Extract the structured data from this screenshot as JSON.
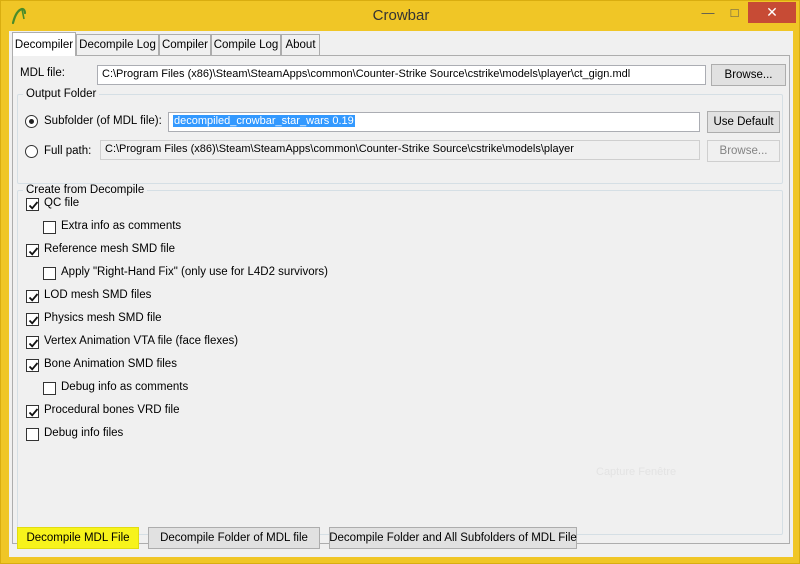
{
  "window": {
    "title": "Crowbar",
    "controls": {
      "minimize": "—",
      "maximize": "□",
      "close": "✕"
    }
  },
  "tabs": [
    "Decompiler",
    "Decompile Log",
    "Compiler",
    "Compile Log",
    "About"
  ],
  "mdl_file": {
    "label": "MDL file:",
    "value": "C:\\Program Files (x86)\\Steam\\SteamApps\\common\\Counter-Strike Source\\cstrike\\models\\player\\ct_gign.mdl",
    "browse": "Browse..."
  },
  "output_folder": {
    "title": "Output Folder",
    "subfolder": {
      "label": "Subfolder (of MDL file):",
      "value": "decompiled_crowbar_star_wars 0.19",
      "selected": true,
      "button": "Use Default"
    },
    "full_path": {
      "label": "Full path:",
      "value": "C:\\Program Files (x86)\\Steam\\SteamApps\\common\\Counter-Strike Source\\cstrike\\models\\player",
      "selected": false,
      "browse": "Browse..."
    }
  },
  "create_from_decompile": {
    "title": "Create from Decompile",
    "options": [
      {
        "label": "QC file",
        "checked": true
      },
      {
        "label": "Extra info as comments",
        "checked": false
      },
      {
        "label": "Reference mesh SMD file",
        "checked": true
      },
      {
        "label": "Apply \"Right-Hand Fix\" (only use for L4D2 survivors)",
        "checked": false
      },
      {
        "label": "LOD mesh SMD files",
        "checked": true
      },
      {
        "label": "Physics mesh SMD file",
        "checked": true
      },
      {
        "label": "Vertex Animation VTA file (face flexes)",
        "checked": true
      },
      {
        "label": "Bone Animation SMD files",
        "checked": true
      },
      {
        "label": "Debug info as comments",
        "checked": false
      },
      {
        "label": "Procedural bones VRD file",
        "checked": true
      },
      {
        "label": "Debug info files",
        "checked": false
      }
    ]
  },
  "watermark": "Capture Fenêtre",
  "actions": {
    "decompile_mdl": "Decompile MDL File",
    "decompile_folder": "Decompile Folder of MDL file",
    "decompile_folder_all": "Decompile Folder and All Subfolders of MDL File"
  },
  "colors": {
    "frame": "#f0c626",
    "highlight": "#f7f31b",
    "selection": "#3399ff",
    "close": "#c74b35"
  }
}
